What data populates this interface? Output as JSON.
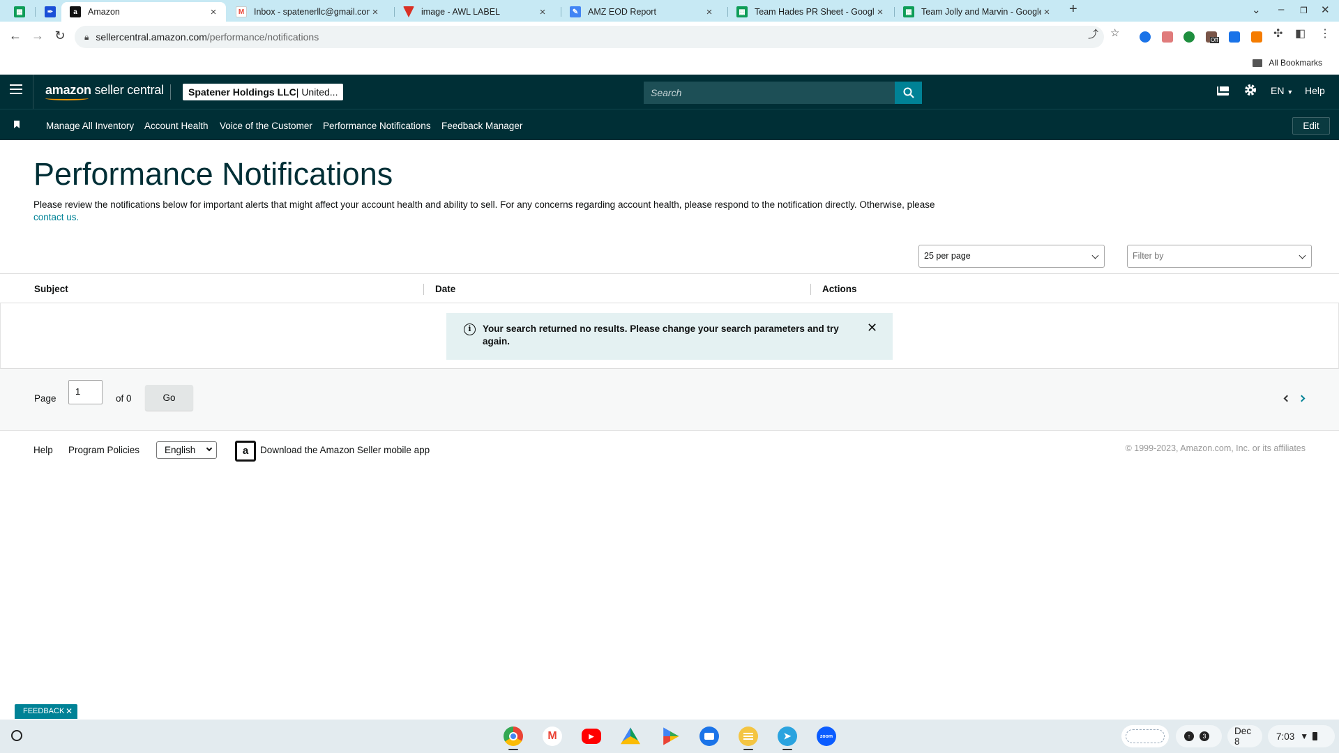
{
  "browser": {
    "tabs": [
      {
        "title": "",
        "favicon": "sheets-icon",
        "color": "#0f9d58"
      },
      {
        "title": "",
        "favicon": "quill-icon",
        "color": "#1a4fd6"
      },
      {
        "title": "Amazon",
        "favicon": "amazon-icon",
        "color": "#111111",
        "active": true
      },
      {
        "title": "Inbox - spatenerllc@gmail.com",
        "favicon": "gmail-icon",
        "color": "#ea4335"
      },
      {
        "title": "image - AWL LABEL",
        "favicon": "awl-icon",
        "color": "#d93025"
      },
      {
        "title": "AMZ EOD Report",
        "favicon": "pencil-icon",
        "color": "#4285f4"
      },
      {
        "title": "Team Hades PR Sheet - Google",
        "favicon": "sheets-icon",
        "color": "#0f9d58"
      },
      {
        "title": "Team Jolly and Marvin - Google",
        "favicon": "sheets-icon",
        "color": "#0f9d58"
      }
    ],
    "url_host": "sellercentral.amazon.com",
    "url_path": "/performance/notifications",
    "all_bookmarks": "All Bookmarks",
    "extension_badge": "Off"
  },
  "header": {
    "logo_bold": "amazon",
    "logo_rest": " seller central",
    "account_name": "Spatener Holdings LLC",
    "account_region": " | United...",
    "search_placeholder": "Search",
    "language": "EN",
    "help": "Help"
  },
  "nav": {
    "items": [
      "Manage All Inventory",
      "Account Health",
      "Voice of the Customer",
      "Performance Notifications",
      "Feedback Manager"
    ],
    "edit": "Edit"
  },
  "page": {
    "title": "Performance Notifications",
    "intro_text": "Please review the notifications below for important alerts that might affect your account health and ability to sell. For any concerns regarding account health, please respond to the notification directly. Otherwise, please ",
    "contact_link": "contact us."
  },
  "filters": {
    "per_page": "25 per page",
    "filter_placeholder": "Filter by"
  },
  "table": {
    "columns": [
      "Subject",
      "Date",
      "Actions"
    ],
    "empty_message": "Your search returned no results. Please change your search parameters and try again."
  },
  "pagination": {
    "page_label": "Page",
    "current_page": "1",
    "of_label": "of 0",
    "go": "Go"
  },
  "footer": {
    "help": "Help",
    "program_policies": "Program Policies",
    "language": "English",
    "download_app": "Download the Amazon Seller mobile app",
    "copyright": "© 1999-2023, Amazon.com, Inc. or its affiliates"
  },
  "feedback": "FEEDBACK",
  "shelf": {
    "apps": [
      {
        "name": "chrome-icon",
        "color": "#4285f4"
      },
      {
        "name": "gmail-icon",
        "color": "#ea4335"
      },
      {
        "name": "youtube-icon",
        "color": "#ff0000"
      },
      {
        "name": "drive-icon",
        "color": "#0f9d58"
      },
      {
        "name": "play-store-icon",
        "color": "#34a853"
      },
      {
        "name": "files-icon",
        "color": "#1a73e8"
      },
      {
        "name": "notes-icon",
        "color": "#f4c542"
      },
      {
        "name": "telegram-icon",
        "color": "#2aa3df"
      },
      {
        "name": "zoom-icon",
        "color": "#0b5cff",
        "label": "zoom"
      }
    ],
    "notification_count": "3",
    "date": "Dec 8",
    "time": "7:03"
  }
}
